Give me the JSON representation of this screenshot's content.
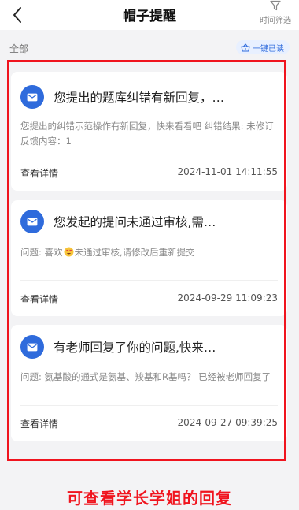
{
  "header": {
    "title": "帽子提醒",
    "filter_label": "时间筛选"
  },
  "toolbar": {
    "all_label": "全部",
    "read_all_label": "一键已读"
  },
  "notifications": [
    {
      "title": "您提出的题库纠错有新回复，…",
      "body_lines": [
        "您提出的纠错示范操作有新回复，快来看看吧 纠错结果: 未修订",
        "反馈内容：1"
      ],
      "detail_label": "查看详情",
      "time": "2024-11-01 14:11:55"
    },
    {
      "title": "您发起的提问未通过审核,需…",
      "body_pre": "问题: 喜欢",
      "body_post": "未通过审核,请修改后重新提交",
      "detail_label": "查看详情",
      "time": "2024-09-29 11:09:23"
    },
    {
      "title": "有老师回复了你的问题,快来…",
      "body": "问题: 氨基酸的通式是氨基、羧基和R基吗？ 已经被老师回复了",
      "detail_label": "查看详情",
      "time": "2024-09-27 09:39:25"
    }
  ],
  "caption": "可查看学长学姐的回复",
  "colors": {
    "accent": "#2f6bdc",
    "highlight": "#f0141e",
    "background": "#f3f3f5"
  }
}
